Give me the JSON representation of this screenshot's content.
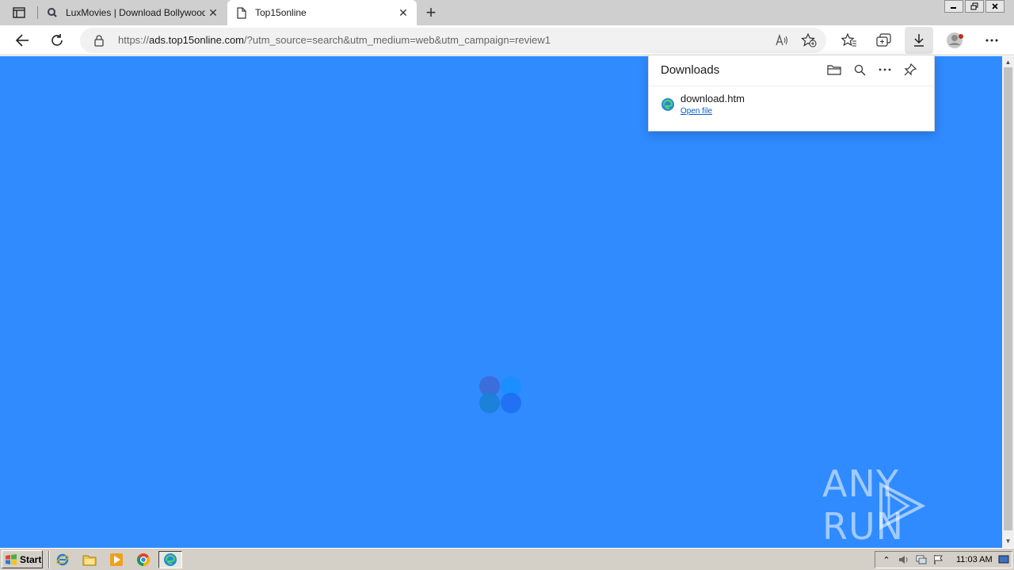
{
  "browser": {
    "tabs": [
      {
        "title": "LuxMovies | Download Bollywood",
        "active": false
      },
      {
        "title": "Top15online",
        "active": true
      }
    ],
    "address": {
      "scheme": "https://",
      "host": "ads.top15online.com",
      "path": "/?utm_source=search&utm_medium=web&utm_campaign=review1"
    }
  },
  "downloads": {
    "title": "Downloads",
    "items": [
      {
        "filename": "download.htm",
        "action": "Open file"
      }
    ]
  },
  "page": {
    "background": "#2f8bff",
    "loader_colors": [
      "#3d6ad6",
      "#1a8fff",
      "#1a7fd6",
      "#1f6ef2"
    ]
  },
  "watermark": {
    "text": "ANY RUN"
  },
  "taskbar": {
    "start_label": "Start",
    "clock": "11:03 AM"
  }
}
